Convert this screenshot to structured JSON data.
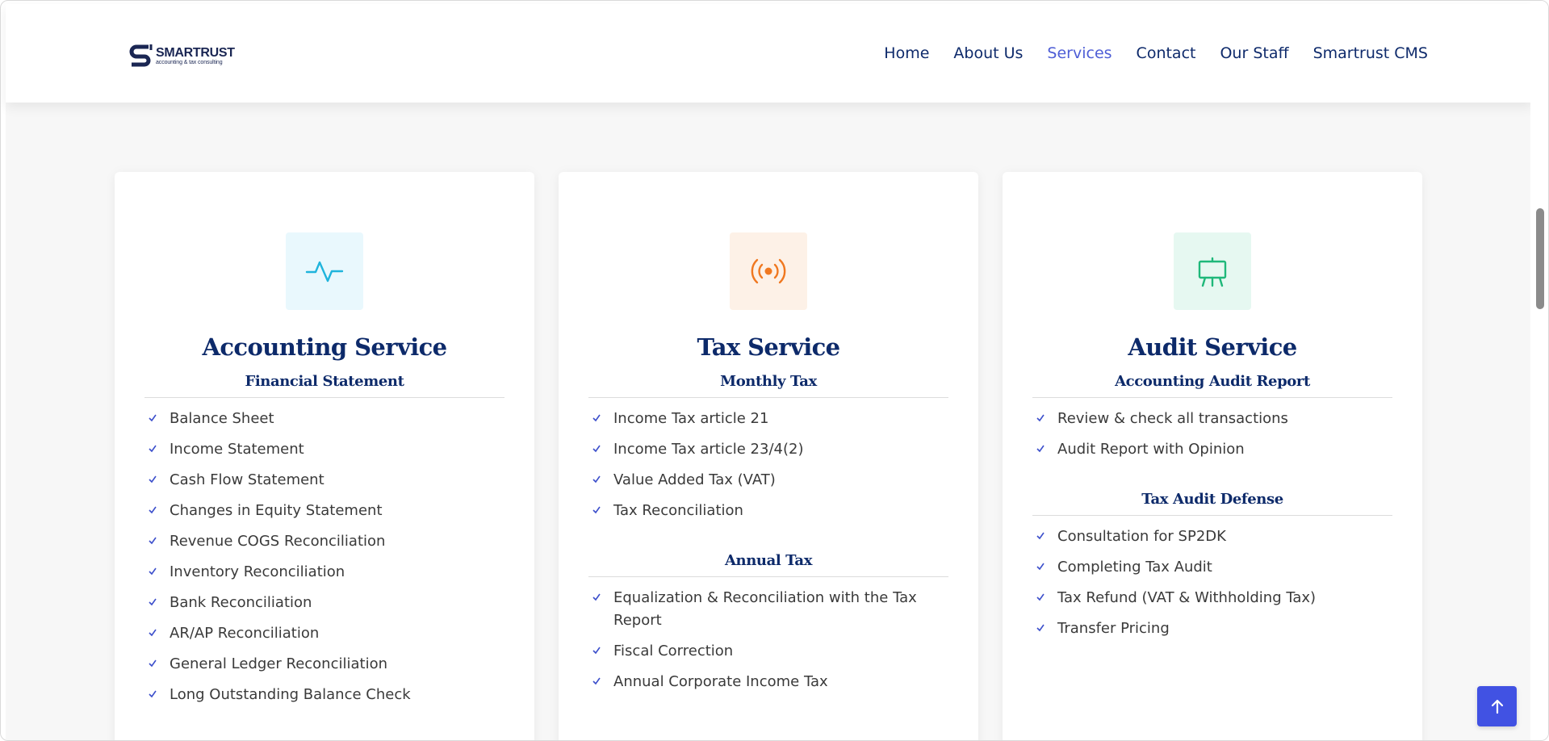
{
  "brand": {
    "name": "SMARTRUST",
    "tagline": "accounting & tax consulting",
    "color": "#1a2653"
  },
  "nav": {
    "items": [
      {
        "label": "Home",
        "active": false
      },
      {
        "label": "About Us",
        "active": false
      },
      {
        "label": "Services",
        "active": true
      },
      {
        "label": "Contact",
        "active": false
      },
      {
        "label": "Our Staff",
        "active": false
      },
      {
        "label": "Smartrust CMS",
        "active": false
      }
    ],
    "color": "#0e2a6b",
    "active_color": "#4e5ed6"
  },
  "cards": [
    {
      "icon": "pulse-icon",
      "icon_color": "#1fb4dc",
      "title": "Accounting Service",
      "sections": [
        {
          "title": "Financial Statement",
          "items": [
            "Balance Sheet",
            "Income Statement",
            "Cash Flow Statement",
            "Changes in Equity Statement",
            "Revenue COGS Reconciliation",
            "Inventory Reconciliation",
            "Bank Reconciliation",
            "AR/AP Reconciliation",
            "General Ledger Reconciliation",
            "Long Outstanding Balance Check"
          ]
        }
      ]
    },
    {
      "icon": "broadcast-icon",
      "icon_color": "#f07820",
      "title": "Tax Service",
      "sections": [
        {
          "title": "Monthly Tax",
          "items": [
            "Income Tax article 21",
            "Income Tax article 23/4(2)",
            "Value Added Tax (VAT)",
            "Tax Reconciliation"
          ]
        },
        {
          "title": "Annual Tax",
          "items": [
            "Equalization & Reconciliation with the Tax Report",
            "Fiscal Correction",
            "Annual Corporate Income Tax"
          ]
        }
      ]
    },
    {
      "icon": "easel-icon",
      "icon_color": "#1fb87a",
      "title": "Audit Service",
      "sections": [
        {
          "title": "Accounting Audit Report",
          "items": [
            "Review & check all transactions",
            "Audit Report with Opinion"
          ]
        },
        {
          "title": "Tax Audit Defense",
          "items": [
            "Consultation for SP2DK",
            "Completing Tax Audit",
            "Tax Refund (VAT & Withholding Tax)",
            "Transfer Pricing"
          ]
        }
      ]
    }
  ],
  "accent_color": "#4152e3",
  "check_color": "#3b4ecb"
}
